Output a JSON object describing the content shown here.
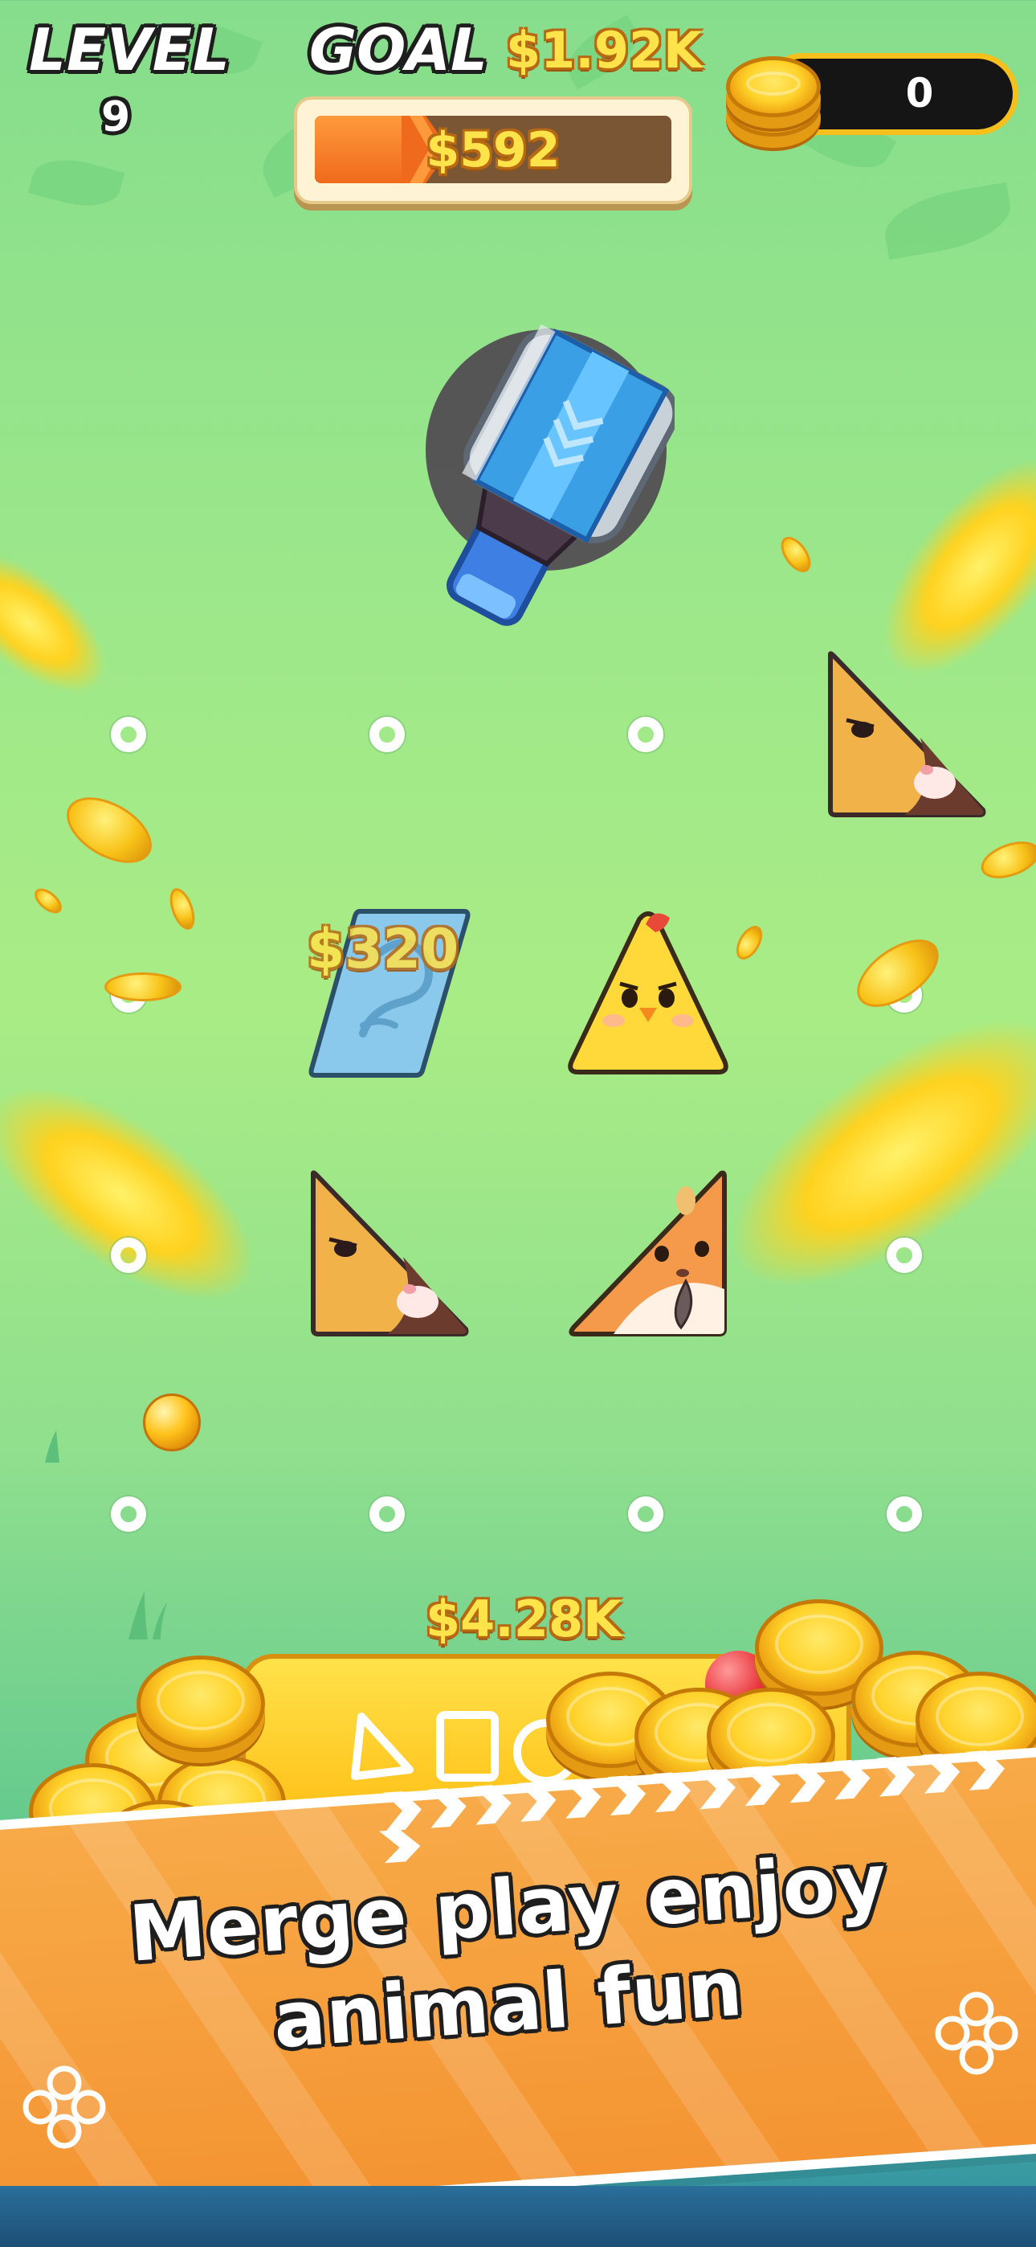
{
  "hud": {
    "level_label": "LEVEL",
    "level_value": "9",
    "goal_label": "GOAL",
    "goal_value": "$1.92K",
    "progress_value": "$592",
    "progress_fraction": 0.31,
    "coin_count": "0"
  },
  "board": {
    "floating_reward": "$320",
    "pieces": [
      {
        "name": "sloth-triangle-top-right",
        "icon": "sloth-icon"
      },
      {
        "name": "blue-parallelogram",
        "icon": "blue-parallelogram-icon"
      },
      {
        "name": "chick-triangle",
        "icon": "chick-icon"
      },
      {
        "name": "sloth-triangle-bottom-left",
        "icon": "sloth-icon"
      },
      {
        "name": "hamster-triangle",
        "icon": "hamster-icon"
      }
    ]
  },
  "collector": {
    "total": "$4.28K"
  },
  "banner": {
    "line1": "Merge play enjoy",
    "line2": "animal fun"
  },
  "colors": {
    "accent_gold": "#ffd22a",
    "banner_orange": "#f5a03c",
    "progress_orange": "#f27a2a",
    "background_green": "#9ee88a"
  }
}
